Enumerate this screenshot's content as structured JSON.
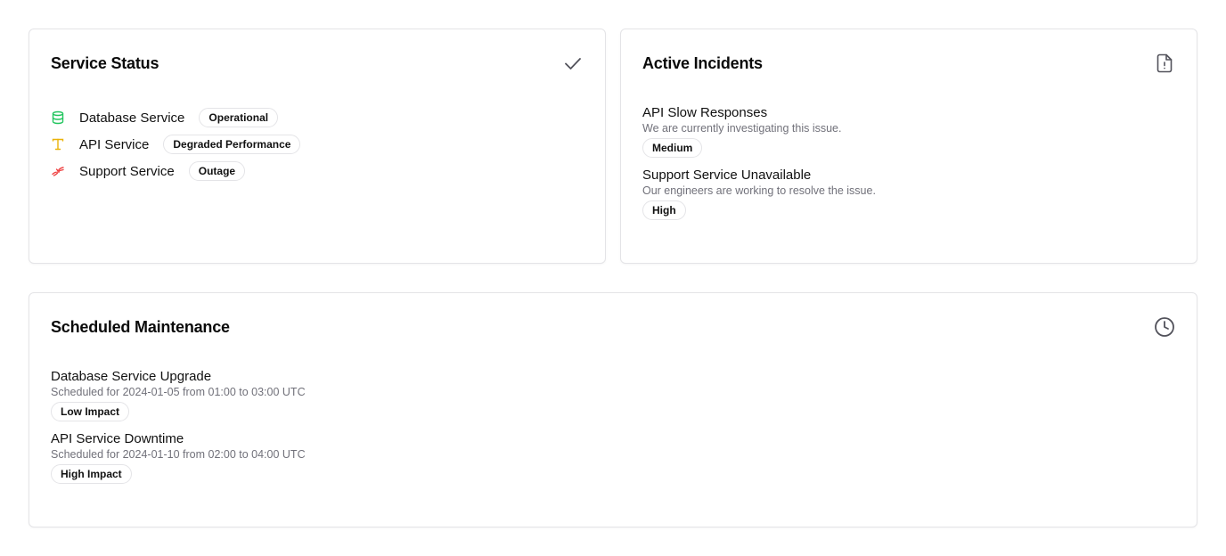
{
  "status_card": {
    "title": "Service Status",
    "header_icon": "check-icon",
    "services": [
      {
        "name": "Database Service",
        "status": "Operational",
        "icon": "database-icon",
        "color": "#22c55e"
      },
      {
        "name": "API Service",
        "status": "Degraded Performance",
        "icon": "type-icon",
        "color": "#eab308"
      },
      {
        "name": "Support Service",
        "status": "Outage",
        "icon": "unlink-icon",
        "color": "#ef4444"
      }
    ]
  },
  "incidents_card": {
    "title": "Active Incidents",
    "header_icon": "file-alert-icon",
    "incidents": [
      {
        "title": "API Slow Responses",
        "description": "We are currently investigating this issue.",
        "severity": "Medium"
      },
      {
        "title": "Support Service Unavailable",
        "description": "Our engineers are working to resolve the issue.",
        "severity": "High"
      }
    ]
  },
  "maintenance_card": {
    "title": "Scheduled Maintenance",
    "header_icon": "clock-icon",
    "items": [
      {
        "title": "Database Service Upgrade",
        "description": "Scheduled for 2024-01-05 from 01:00 to 03:00 UTC",
        "impact": "Low Impact"
      },
      {
        "title": "API Service Downtime",
        "description": "Scheduled for 2024-01-10 from 02:00 to 04:00 UTC",
        "impact": "High Impact"
      }
    ]
  },
  "colors": {
    "icon_gray": "#52525b",
    "border": "#e4e4e7",
    "muted_text": "#71717a"
  }
}
